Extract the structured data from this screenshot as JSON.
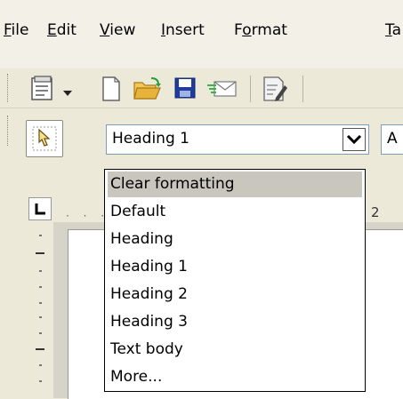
{
  "menubar": {
    "items": [
      {
        "label": "File",
        "accel": "F",
        "rest": "ile"
      },
      {
        "label": "Edit",
        "accel": "E",
        "rest": "dit"
      },
      {
        "label": "View",
        "accel": "V",
        "rest": "iew"
      },
      {
        "label": "Insert",
        "accel": "I",
        "rest": "nsert"
      },
      {
        "label": "Format",
        "pre": "F",
        "accel": "o",
        "rest": "rmat"
      },
      {
        "label": "Ta",
        "accel": "T",
        "rest": "a"
      }
    ]
  },
  "style_toolbar": {
    "style_value": "Heading 1",
    "font_value": "A"
  },
  "ruler": {
    "right_number": "2"
  },
  "style_dropdown": {
    "selected_index": 0,
    "options": [
      "Clear formatting",
      "Default",
      "Heading",
      "Heading 1",
      "Heading 2",
      "Heading 3",
      "Text body",
      "More..."
    ]
  },
  "colors": {
    "selection": "#c9c7bd",
    "toolbar_bg": "#ece9d8",
    "save_icon": "#1f3c9c",
    "folder_icon": "#e8b33a"
  }
}
